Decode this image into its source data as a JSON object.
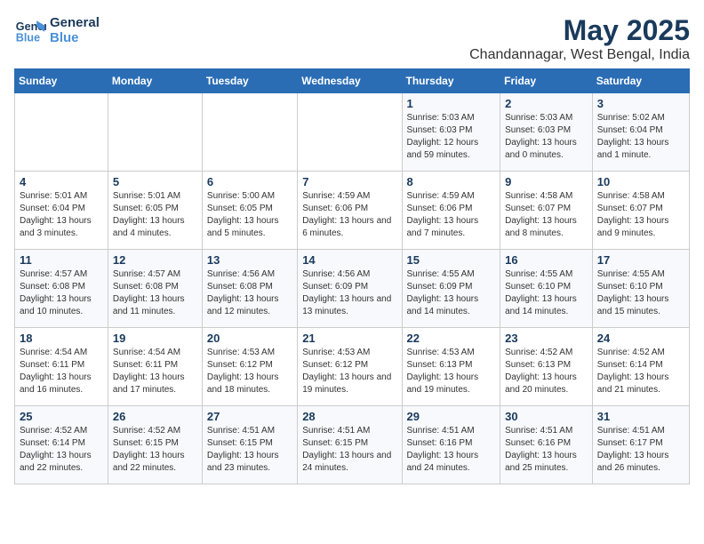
{
  "logo": {
    "line1": "General",
    "line2": "Blue"
  },
  "title": "May 2025",
  "subtitle": "Chandannagar, West Bengal, India",
  "headers": [
    "Sunday",
    "Monday",
    "Tuesday",
    "Wednesday",
    "Thursday",
    "Friday",
    "Saturday"
  ],
  "weeks": [
    [
      {
        "day": "",
        "sunrise": "",
        "sunset": "",
        "daylight": ""
      },
      {
        "day": "",
        "sunrise": "",
        "sunset": "",
        "daylight": ""
      },
      {
        "day": "",
        "sunrise": "",
        "sunset": "",
        "daylight": ""
      },
      {
        "day": "",
        "sunrise": "",
        "sunset": "",
        "daylight": ""
      },
      {
        "day": "1",
        "sunrise": "Sunrise: 5:03 AM",
        "sunset": "Sunset: 6:03 PM",
        "daylight": "Daylight: 12 hours and 59 minutes."
      },
      {
        "day": "2",
        "sunrise": "Sunrise: 5:03 AM",
        "sunset": "Sunset: 6:03 PM",
        "daylight": "Daylight: 13 hours and 0 minutes."
      },
      {
        "day": "3",
        "sunrise": "Sunrise: 5:02 AM",
        "sunset": "Sunset: 6:04 PM",
        "daylight": "Daylight: 13 hours and 1 minute."
      }
    ],
    [
      {
        "day": "4",
        "sunrise": "Sunrise: 5:01 AM",
        "sunset": "Sunset: 6:04 PM",
        "daylight": "Daylight: 13 hours and 3 minutes."
      },
      {
        "day": "5",
        "sunrise": "Sunrise: 5:01 AM",
        "sunset": "Sunset: 6:05 PM",
        "daylight": "Daylight: 13 hours and 4 minutes."
      },
      {
        "day": "6",
        "sunrise": "Sunrise: 5:00 AM",
        "sunset": "Sunset: 6:05 PM",
        "daylight": "Daylight: 13 hours and 5 minutes."
      },
      {
        "day": "7",
        "sunrise": "Sunrise: 4:59 AM",
        "sunset": "Sunset: 6:06 PM",
        "daylight": "Daylight: 13 hours and 6 minutes."
      },
      {
        "day": "8",
        "sunrise": "Sunrise: 4:59 AM",
        "sunset": "Sunset: 6:06 PM",
        "daylight": "Daylight: 13 hours and 7 minutes."
      },
      {
        "day": "9",
        "sunrise": "Sunrise: 4:58 AM",
        "sunset": "Sunset: 6:07 PM",
        "daylight": "Daylight: 13 hours and 8 minutes."
      },
      {
        "day": "10",
        "sunrise": "Sunrise: 4:58 AM",
        "sunset": "Sunset: 6:07 PM",
        "daylight": "Daylight: 13 hours and 9 minutes."
      }
    ],
    [
      {
        "day": "11",
        "sunrise": "Sunrise: 4:57 AM",
        "sunset": "Sunset: 6:08 PM",
        "daylight": "Daylight: 13 hours and 10 minutes."
      },
      {
        "day": "12",
        "sunrise": "Sunrise: 4:57 AM",
        "sunset": "Sunset: 6:08 PM",
        "daylight": "Daylight: 13 hours and 11 minutes."
      },
      {
        "day": "13",
        "sunrise": "Sunrise: 4:56 AM",
        "sunset": "Sunset: 6:08 PM",
        "daylight": "Daylight: 13 hours and 12 minutes."
      },
      {
        "day": "14",
        "sunrise": "Sunrise: 4:56 AM",
        "sunset": "Sunset: 6:09 PM",
        "daylight": "Daylight: 13 hours and 13 minutes."
      },
      {
        "day": "15",
        "sunrise": "Sunrise: 4:55 AM",
        "sunset": "Sunset: 6:09 PM",
        "daylight": "Daylight: 13 hours and 14 minutes."
      },
      {
        "day": "16",
        "sunrise": "Sunrise: 4:55 AM",
        "sunset": "Sunset: 6:10 PM",
        "daylight": "Daylight: 13 hours and 14 minutes."
      },
      {
        "day": "17",
        "sunrise": "Sunrise: 4:55 AM",
        "sunset": "Sunset: 6:10 PM",
        "daylight": "Daylight: 13 hours and 15 minutes."
      }
    ],
    [
      {
        "day": "18",
        "sunrise": "Sunrise: 4:54 AM",
        "sunset": "Sunset: 6:11 PM",
        "daylight": "Daylight: 13 hours and 16 minutes."
      },
      {
        "day": "19",
        "sunrise": "Sunrise: 4:54 AM",
        "sunset": "Sunset: 6:11 PM",
        "daylight": "Daylight: 13 hours and 17 minutes."
      },
      {
        "day": "20",
        "sunrise": "Sunrise: 4:53 AM",
        "sunset": "Sunset: 6:12 PM",
        "daylight": "Daylight: 13 hours and 18 minutes."
      },
      {
        "day": "21",
        "sunrise": "Sunrise: 4:53 AM",
        "sunset": "Sunset: 6:12 PM",
        "daylight": "Daylight: 13 hours and 19 minutes."
      },
      {
        "day": "22",
        "sunrise": "Sunrise: 4:53 AM",
        "sunset": "Sunset: 6:13 PM",
        "daylight": "Daylight: 13 hours and 19 minutes."
      },
      {
        "day": "23",
        "sunrise": "Sunrise: 4:52 AM",
        "sunset": "Sunset: 6:13 PM",
        "daylight": "Daylight: 13 hours and 20 minutes."
      },
      {
        "day": "24",
        "sunrise": "Sunrise: 4:52 AM",
        "sunset": "Sunset: 6:14 PM",
        "daylight": "Daylight: 13 hours and 21 minutes."
      }
    ],
    [
      {
        "day": "25",
        "sunrise": "Sunrise: 4:52 AM",
        "sunset": "Sunset: 6:14 PM",
        "daylight": "Daylight: 13 hours and 22 minutes."
      },
      {
        "day": "26",
        "sunrise": "Sunrise: 4:52 AM",
        "sunset": "Sunset: 6:15 PM",
        "daylight": "Daylight: 13 hours and 22 minutes."
      },
      {
        "day": "27",
        "sunrise": "Sunrise: 4:51 AM",
        "sunset": "Sunset: 6:15 PM",
        "daylight": "Daylight: 13 hours and 23 minutes."
      },
      {
        "day": "28",
        "sunrise": "Sunrise: 4:51 AM",
        "sunset": "Sunset: 6:15 PM",
        "daylight": "Daylight: 13 hours and 24 minutes."
      },
      {
        "day": "29",
        "sunrise": "Sunrise: 4:51 AM",
        "sunset": "Sunset: 6:16 PM",
        "daylight": "Daylight: 13 hours and 24 minutes."
      },
      {
        "day": "30",
        "sunrise": "Sunrise: 4:51 AM",
        "sunset": "Sunset: 6:16 PM",
        "daylight": "Daylight: 13 hours and 25 minutes."
      },
      {
        "day": "31",
        "sunrise": "Sunrise: 4:51 AM",
        "sunset": "Sunset: 6:17 PM",
        "daylight": "Daylight: 13 hours and 26 minutes."
      }
    ]
  ]
}
